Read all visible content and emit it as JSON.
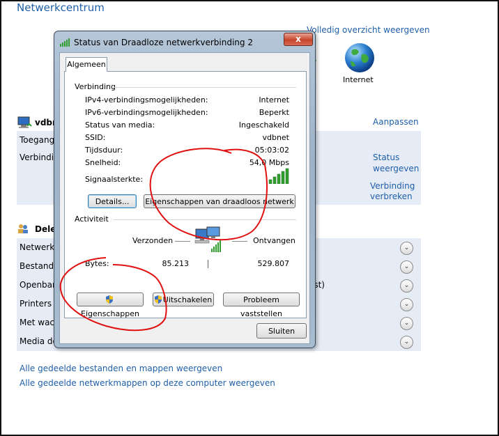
{
  "page": {
    "title": "Netwerkcentrum",
    "full_overview_link": "Volledig overzicht weergeven",
    "internet_label": "Internet",
    "network_name": "vdbr",
    "customize_link": "Aanpassen",
    "row_access": "Toegang",
    "row_connections": "Verbindi",
    "status_link_1": "Status",
    "status_link_2": "weergeven",
    "disconnect_link_1": "Verbinding",
    "disconnect_link_2": "verbreken",
    "sharing_title": "Dele",
    "sharing_rows": [
      "Netwerkc",
      "Bestande",
      "Openbar",
      "Printers o",
      "Met wach",
      "Media de"
    ],
    "sharing_trailing_text": "ist)",
    "bottom_link_1": "Alle gedeelde bestanden en mappen weergeven",
    "bottom_link_2": "Alle gedeelde netwerkmappen op deze computer weergeven"
  },
  "dialog": {
    "title": "Status van Draadloze netwerkverbinding 2",
    "close_label": "x",
    "tab_label": "Algemeen",
    "connection_section": "Verbinding",
    "fields": [
      {
        "label": "IPv4-verbindingsmogelijkheden:",
        "value": "Internet"
      },
      {
        "label": "IPv6-verbindingsmogelijkheden:",
        "value": "Beperkt"
      },
      {
        "label": "Status van media:",
        "value": "Ingeschakeld"
      },
      {
        "label": "SSID:",
        "value": "vdbnet"
      },
      {
        "label": "Tijdsduur:",
        "value": "05:03:02"
      },
      {
        "label": "Snelheid:",
        "value": "54,0 Mbps"
      }
    ],
    "signal_label": "Signaalsterkte:",
    "details_button": "Details...",
    "wireless_props_button": "Eigenschappen van draadloos netwerk",
    "activity_section": "Activiteit",
    "sent_label": "Verzonden",
    "received_label": "Ontvangen",
    "bytes_label": "Bytes:",
    "bytes_sent": "85.213",
    "bytes_received": "529.807",
    "properties_button": "Eigenschappen",
    "disable_button": "Uitschakelen",
    "diagnose_button": "Probleem vaststellen",
    "close_button": "Sluiten"
  },
  "colors": {
    "link": "#1f5fa8",
    "annotation": "#e01010",
    "signal": "#2f9e2f"
  }
}
